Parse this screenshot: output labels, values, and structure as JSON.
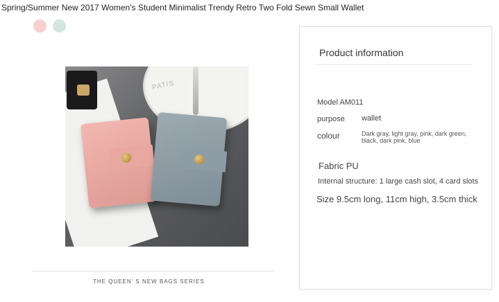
{
  "product": {
    "title": "Spring/Summer New 2017 Women's Student Minimalist Trendy Retro Two Fold Sewn Small Wallet"
  },
  "swatches": [
    {
      "color": "#f6d0cf"
    },
    {
      "color": "#d3e6df"
    }
  ],
  "photo": {
    "plate_text": "PATIS"
  },
  "caption": "THE QUEEN' S NEW BAGS SERIES",
  "info": {
    "heading": "Product information",
    "model": "Model AM011",
    "purpose_label": "purpose",
    "purpose_value": "wallet",
    "colour_label": "colour",
    "colour_value": "Dark gray, light gray, pink, dark green, black, dark pink, blue",
    "fabric": "Fabric PU",
    "internal": "Internal structure: 1 large cash slot, 4 card slots",
    "size": "Size 9.5cm long, 11cm high, 3.5cm thick"
  }
}
